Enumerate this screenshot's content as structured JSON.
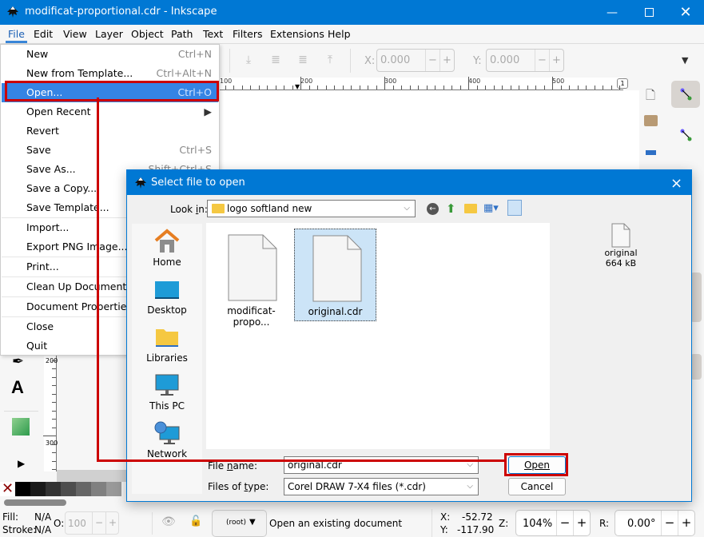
{
  "window": {
    "title": "modificat-proportional.cdr - Inkscape",
    "minimize_icon": "minimize-icon",
    "maximize_icon": "maximize-icon",
    "close_icon": "close-icon"
  },
  "menubar": {
    "items": [
      {
        "label": "File",
        "active": true
      },
      {
        "label": "Edit"
      },
      {
        "label": "View"
      },
      {
        "label": "Layer"
      },
      {
        "label": "Object"
      },
      {
        "label": "Path"
      },
      {
        "label": "Text"
      },
      {
        "label": "Filters"
      },
      {
        "label": "Extensions"
      },
      {
        "label": "Help"
      }
    ]
  },
  "file_menu": {
    "items": [
      {
        "label": "New",
        "shortcut": "Ctrl+N"
      },
      {
        "label": "New from Template...",
        "shortcut": "Ctrl+Alt+N"
      },
      {
        "label": "Open...",
        "shortcut": "Ctrl+O",
        "highlighted": true
      },
      {
        "label": "Open Recent",
        "submenu": true
      },
      {
        "label": "Revert",
        "shortcut": ""
      },
      {
        "label": "Save",
        "shortcut": "Ctrl+S"
      },
      {
        "label": "Save As...",
        "shortcut": "Shift+Ctrl+S"
      },
      {
        "label": "Save a Copy...",
        "shortcut": ""
      },
      {
        "label": "Save Template...",
        "shortcut": ""
      },
      {
        "label": "Import...",
        "shortcut": ""
      },
      {
        "label": "Export PNG Image...",
        "shortcut": ""
      },
      {
        "label": "Print...",
        "shortcut": ""
      },
      {
        "label": "Clean Up Document",
        "shortcut": ""
      },
      {
        "label": "Document Properties...",
        "shortcut": ""
      },
      {
        "label": "Close",
        "shortcut": ""
      },
      {
        "label": "Quit",
        "shortcut": ""
      }
    ]
  },
  "toolbar": {
    "x_label": "X:",
    "x_value": "0.000",
    "y_label": "Y:",
    "y_value": "0.000",
    "minus": "−",
    "plus": "+"
  },
  "ruler": {
    "top_labels": [
      "100",
      "200",
      "300",
      "400",
      "500"
    ],
    "left_labels": [
      "200",
      "300"
    ],
    "page_indicator": "1"
  },
  "dialog": {
    "title": "Select file to open",
    "look_in_label": "Look in:",
    "look_in_value": "logo softland new",
    "places": [
      {
        "label": "Home",
        "icon": "home-icon"
      },
      {
        "label": "Desktop",
        "icon": "desktop-icon"
      },
      {
        "label": "Libraries",
        "icon": "libraries-icon"
      },
      {
        "label": "This PC",
        "icon": "this-pc-icon"
      },
      {
        "label": "Network",
        "icon": "network-icon"
      }
    ],
    "files": [
      {
        "name": "modificat-propo...",
        "selected": false
      },
      {
        "name": "original.cdr",
        "selected": true
      }
    ],
    "preview": {
      "name": "original",
      "size": "664 kB"
    },
    "file_name_label": "File name:",
    "file_name_value": "original.cdr",
    "file_type_label": "Files of type:",
    "file_type_value": "Corel DRAW 7-X4 files (*.cdr)",
    "open_button": "Open",
    "cancel_button": "Cancel",
    "close_icon": "×"
  },
  "statusbar": {
    "fill_label": "Fill:",
    "fill_value": "N/A",
    "stroke_label": "Stroke:",
    "stroke_value": "N/A",
    "opacity_label": "O:",
    "opacity_value": "100",
    "layer_value": "(root)",
    "message": "Open an existing document",
    "x_label": "X:",
    "x_value": "-52.72",
    "y_label": "Y:",
    "y_value": "-117.90",
    "zoom_label": "Z:",
    "zoom_value": "104%",
    "rotate_label": "R:",
    "rotate_value": "0.00°"
  },
  "palette": [
    "#000000",
    "#1a1a1a",
    "#333333",
    "#4d4d4d",
    "#666666",
    "#808080",
    "#999999",
    "#b3b3b3"
  ],
  "colors": {
    "accent": "#0078d4",
    "highlight": "#3584e4",
    "annotation": "#cc0000",
    "selection": "#cce4f7"
  }
}
